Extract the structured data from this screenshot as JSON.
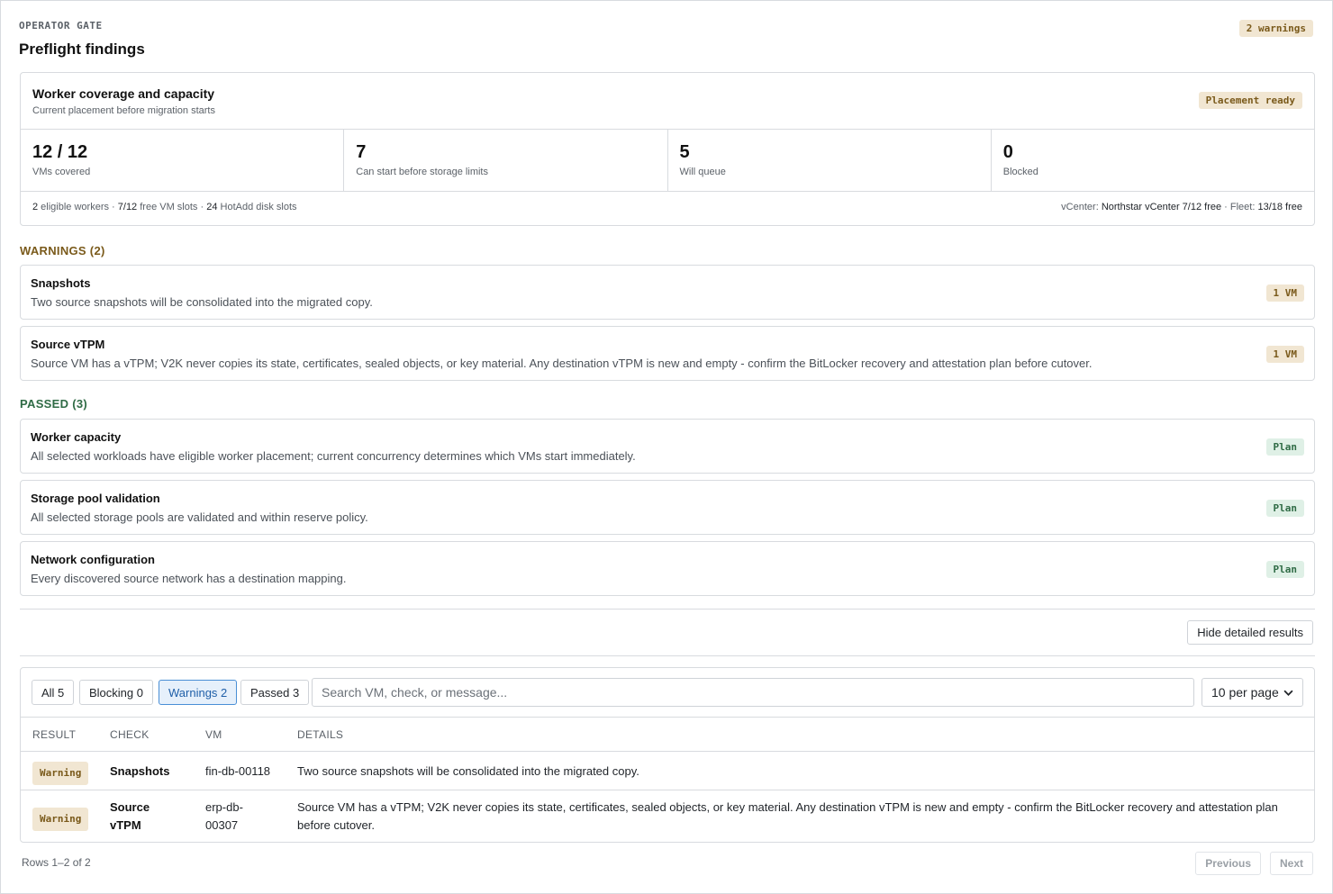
{
  "header": {
    "eyebrow": "OPERATOR GATE",
    "title": "Preflight findings",
    "warnings_badge": "2 warnings"
  },
  "capacity": {
    "title": "Worker coverage and capacity",
    "subtitle": "Current placement before migration starts",
    "status_badge": "Placement ready",
    "stats": [
      {
        "value": "12 / 12",
        "label": "VMs covered"
      },
      {
        "value": "7",
        "label": "Can start before storage limits"
      },
      {
        "value": "5",
        "label": "Will queue"
      },
      {
        "value": "0",
        "label": "Blocked"
      }
    ],
    "footer_left": {
      "workers_count": "2",
      "workers_label": " eligible workers · ",
      "vm_slots": "7/12",
      "vm_slots_label": " free VM slots · ",
      "hotadd": "24",
      "hotadd_label": " HotAdd disk slots"
    },
    "footer_right": {
      "vcenter_label": "vCenter: ",
      "vcenter_value": "Northstar vCenter 7/12 free",
      "fleet_label": " · Fleet: ",
      "fleet_value": "13/18 free"
    }
  },
  "warnings": {
    "heading": "WARNINGS (2)",
    "items": [
      {
        "title": "Snapshots",
        "description": "Two source snapshots will be consolidated into the migrated copy.",
        "badge": "1 VM"
      },
      {
        "title": "Source vTPM",
        "description": "Source VM has a vTPM; V2K never copies its state, certificates, sealed objects, or key material. Any destination vTPM is new and empty - confirm the BitLocker recovery and attestation plan before cutover.",
        "badge": "1 VM"
      }
    ]
  },
  "passed": {
    "heading": "PASSED (3)",
    "items": [
      {
        "title": "Worker capacity",
        "description": "All selected workloads have eligible worker placement; current concurrency determines which VMs start immediately.",
        "badge": "Plan"
      },
      {
        "title": "Storage pool validation",
        "description": "All selected storage pools are validated and within reserve policy.",
        "badge": "Plan"
      },
      {
        "title": "Network configuration",
        "description": "Every discovered source network has a destination mapping.",
        "badge": "Plan"
      }
    ]
  },
  "details_toggle": "Hide detailed results",
  "results": {
    "filters": [
      {
        "label": "All 5"
      },
      {
        "label": "Blocking 0"
      },
      {
        "label": "Warnings 2"
      },
      {
        "label": "Passed 3"
      }
    ],
    "search_placeholder": "Search VM, check, or message...",
    "per_page": "10 per page",
    "columns": [
      "RESULT",
      "CHECK",
      "VM",
      "DETAILS"
    ],
    "rows": [
      {
        "result": "Warning",
        "check": "Snapshots",
        "vm": "fin-db-00118",
        "details": "Two source snapshots will be consolidated into the migrated copy."
      },
      {
        "result": "Warning",
        "check": "Source vTPM",
        "vm": "erp-db-00307",
        "details": "Source VM has a vTPM; V2K never copies its state, certificates, sealed objects, or key material. Any destination vTPM is new and empty - confirm the BitLocker recovery and attestation plan before cutover."
      }
    ],
    "rows_info": "Rows 1–2 of 2",
    "prev_label": "Previous",
    "next_label": "Next"
  },
  "colors": {
    "warning_accent": "#7a5a1b",
    "warning_bg": "#f1e6d2",
    "pass_accent": "#2f6b45",
    "pass_bg": "#dff0e6",
    "active_filter": "#4a8fd6"
  }
}
